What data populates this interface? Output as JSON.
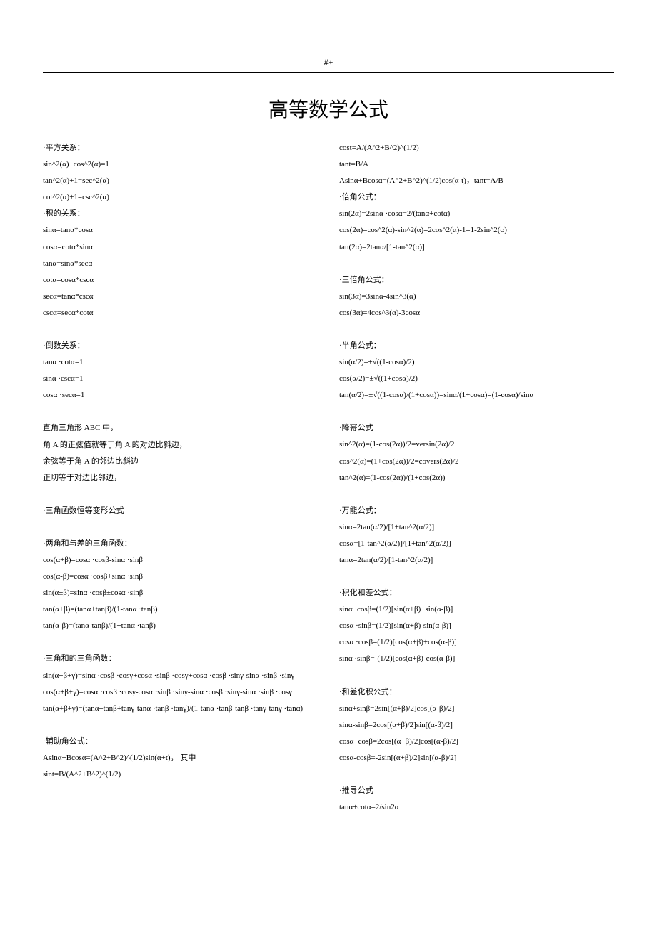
{
  "header_mark": "#+",
  "title": "高等数学公式",
  "left": [
    "·平方关系：",
    "sin^2(α)+cos^2(α)=1",
    "tan^2(α)+1=sec^2(α)",
    "cot^2(α)+1=csc^2(α)",
    "·积的关系：",
    "sinα=tanα*cosα",
    "cosα=cotα*sinα",
    "tanα=sinα*secα",
    "cotα=cosα*cscα",
    "secα=tanα*cscα",
    "cscα=secα*cotα",
    "",
    "·倒数关系：",
    "tanα ·cotα=1",
    "sinα ·cscα=1",
    "cosα ·secα=1",
    "",
    "直角三角形 ABC 中，",
    "角 A 的正弦值就等于角 A 的对边比斜边，",
    "余弦等于角 A 的邻边比斜边",
    "正切等于对边比邻边，",
    "",
    "·三角函数恒等变形公式",
    "",
    "·两角和与差的三角函数：",
    "cos(α+β)=cosα ·cosβ-sinα ·sinβ",
    "cos(α-β)=cosα ·cosβ+sinα ·sinβ",
    "sin(α±β)=sinα ·cosβ±cosα ·sinβ",
    "tan(α+β)=(tanα+tanβ)/(1-tanα ·tanβ)",
    "tan(α-β)=(tanα-tanβ)/(1+tanα ·tanβ)",
    "",
    "·三角和的三角函数：",
    "sin(α+β+γ)=sinα ·cosβ ·cosγ+cosα ·sinβ ·cosγ+cosα ·cosβ ·sinγ-sinα ·sinβ ·sinγ",
    "cos(α+β+γ)=cosα ·cosβ ·cosγ-cosα ·sinβ ·sinγ-sinα ·cosβ ·sinγ-sinα ·sinβ ·cosγ",
    "tan(α+β+γ)=(tanα+tanβ+tanγ-tanα ·tanβ ·tanγ)/(1-tanα ·tanβ-tanβ ·tanγ-tanγ ·tanα)",
    "",
    "·辅助角公式：",
    "Asinα+Bcosα=(A^2+B^2)^(1/2)sin(α+t)， 其中",
    "sint=B/(A^2+B^2)^(1/2)"
  ],
  "right": [
    "cost=A/(A^2+B^2)^(1/2)",
    "tant=B/A",
    "Asinα+Bcosα=(A^2+B^2)^(1/2)cos(α-t)，tant=A/B",
    "·倍角公式：",
    "sin(2α)=2sinα ·cosα=2/(tanα+cotα)",
    "cos(2α)=cos^2(α)-sin^2(α)=2cos^2(α)-1=1-2sin^2(α)",
    "tan(2α)=2tanα/[1-tan^2(α)]",
    "",
    "·三倍角公式：",
    "sin(3α)=3sinα-4sin^3(α)",
    "cos(3α)=4cos^3(α)-3cosα",
    "",
    "·半角公式：",
    "sin(α/2)=±√((1-cosα)/2)",
    "cos(α/2)=±√((1+cosα)/2)",
    "tan(α/2)=±√((1-cosα)/(1+cosα))=sinα/(1+cosα)=(1-cosα)/sinα",
    "",
    "·降幂公式",
    "sin^2(α)=(1-cos(2α))/2=versin(2α)/2",
    "cos^2(α)=(1+cos(2α))/2=covers(2α)/2",
    "tan^2(α)=(1-cos(2α))/(1+cos(2α))",
    "",
    "·万能公式：",
    "sinα=2tan(α/2)/[1+tan^2(α/2)]",
    "cosα=[1-tan^2(α/2)]/[1+tan^2(α/2)]",
    "tanα=2tan(α/2)/[1-tan^2(α/2)]",
    "",
    "·积化和差公式：",
    "sinα ·cosβ=(1/2)[sin(α+β)+sin(α-β)]",
    "cosα ·sinβ=(1/2)[sin(α+β)-sin(α-β)]",
    "cosα ·cosβ=(1/2)[cos(α+β)+cos(α-β)]",
    "sinα ·sinβ=-(1/2)[cos(α+β)-cos(α-β)]",
    "",
    "·和差化积公式：",
    "sinα+sinβ=2sin[(α+β)/2]cos[(α-β)/2]",
    "sinα-sinβ=2cos[(α+β)/2]sin[(α-β)/2]",
    "cosα+cosβ=2cos[(α+β)/2]cos[(α-β)/2]",
    "cosα-cosβ=-2sin[(α+β)/2]sin[(α-β)/2]",
    "",
    "·推导公式",
    "tanα+cotα=2/sin2α"
  ]
}
